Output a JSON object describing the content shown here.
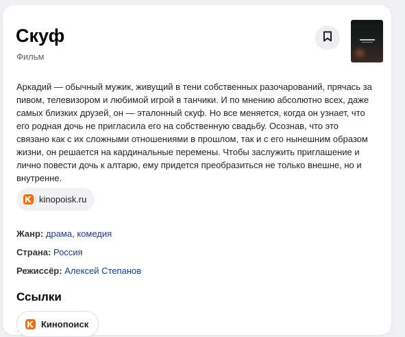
{
  "film": {
    "title": "Скуф",
    "type": "Фильм",
    "description": "Аркадий — обычный мужик, живущий в тени собственных разочарований, прячась за пивом, телевизором и любимой игрой в танчики. И по мнению абсолютно всех, даже самых близких друзей, он — эталонный скуф. Но все меняется, когда он узнает, что его родная дочь не пригласила его на собственную свадьбу. Осознав, что это связано как с их сложными отношениями в прошлом, так и с его нынешним образом жизни, он решается на кардинальные перемены. Чтобы заслужить приглашение и лично повести дочь к алтарю, ему придется преобразиться не только внешне, но и внутренне."
  },
  "source": {
    "label": "kinopoisk.ru"
  },
  "facts": {
    "genre_label": "Жанр:",
    "genre_1": "драма",
    "genre_sep": ", ",
    "genre_2": "комедия",
    "country_label": "Страна:",
    "country": "Россия",
    "director_label": "Режиссёр:",
    "director": "Алексей Степанов"
  },
  "links": {
    "heading": "Ссылки",
    "items": [
      {
        "label": "Кинопоиск"
      }
    ]
  },
  "icons": {
    "bookmark": "bookmark-icon",
    "kinopoisk": "kinopoisk-logo-icon"
  },
  "colors": {
    "link": "#1a3a8a",
    "brand_orange": "#ff6a00",
    "chip_bg": "#f0f1f4"
  }
}
